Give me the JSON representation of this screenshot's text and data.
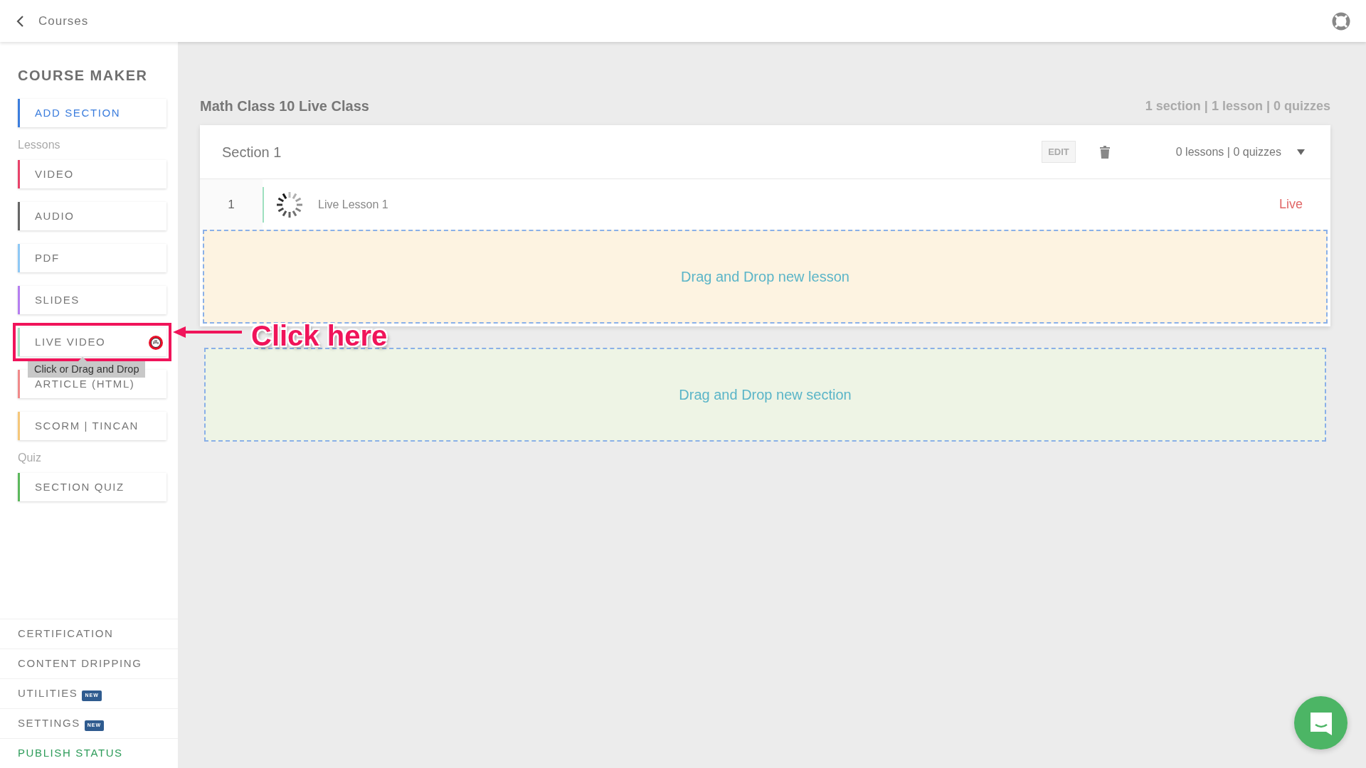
{
  "top_bar": {
    "back_label": "Courses"
  },
  "sidebar": {
    "title": "COURSE MAKER",
    "add_button": {
      "label": "ADD SECTION",
      "color": "#3b7ddd"
    },
    "groups": [
      {
        "heading": "Lessons",
        "items": [
          {
            "label": "VIDEO",
            "color": "#e8436a",
            "annotated": false
          },
          {
            "label": "AUDIO",
            "color": "#666666",
            "annotated": false
          },
          {
            "label": "PDF",
            "color": "#8ec8f5",
            "annotated": false
          },
          {
            "label": "SLIDES",
            "color": "#b57ef0",
            "annotated": false
          },
          {
            "label": "LIVE VIDEO",
            "color": "#a6e3c6",
            "annotated": true,
            "tooltip": "Click or Drag and Drop"
          },
          {
            "label": "ARTICLE (HTML)",
            "color": "#f08a8a",
            "annotated": false
          },
          {
            "label": "SCORM | TINCAN",
            "color": "#f5c77a",
            "annotated": false
          }
        ]
      },
      {
        "heading": "Quiz",
        "items": [
          {
            "label": "SECTION QUIZ",
            "color": "#5cb85c",
            "annotated": false
          }
        ]
      }
    ],
    "footer_items": [
      {
        "label": "CERTIFICATION",
        "kind": "plain"
      },
      {
        "label": "CONTENT DRIPPING",
        "kind": "plain"
      },
      {
        "label": "UTILITIES",
        "kind": "plain",
        "badge": "NEW"
      },
      {
        "label": "SETTINGS",
        "kind": "plain",
        "badge": "NEW"
      },
      {
        "label": "PUBLISH STATUS",
        "kind": "status"
      }
    ]
  },
  "main": {
    "course_title": "Math Class 10 Live Class",
    "summary": "1 section | 1 lesson | 0 quizzes",
    "sections": [
      {
        "title": "Section 1",
        "edit_label": "EDIT",
        "counts": "0 lessons | 0 quizzes",
        "lessons": [
          {
            "number": "1",
            "title": "Live Lesson 1",
            "status": "Live"
          }
        ],
        "lesson_drop": "Drag and Drop new lesson"
      }
    ],
    "section_drop": "Drag and Drop new section"
  },
  "annotation": {
    "label": "Click here"
  }
}
